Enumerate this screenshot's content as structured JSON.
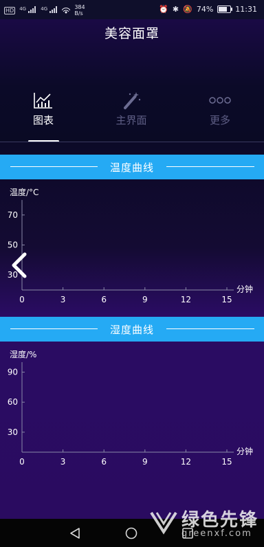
{
  "status_bar": {
    "network_hd": "HD",
    "sim1": "4G",
    "sim2": "4G",
    "speed_value": "384",
    "speed_unit": "B/s",
    "battery": "74%",
    "battery_level": 0.74,
    "time": "11:31"
  },
  "header": {
    "title": "美容面罩"
  },
  "tabs": [
    {
      "label": "图表",
      "icon": "chart-icon",
      "active": true
    },
    {
      "label": "主界面",
      "icon": "magic-wand-icon",
      "active": false
    },
    {
      "label": "更多",
      "icon": "more-dots-icon",
      "active": false
    }
  ],
  "temperature_chart": {
    "section_label": "温度曲线",
    "chart_data": {
      "type": "line",
      "title": "温度曲线",
      "ylabel": "温度/°C",
      "xlabel": "分钟",
      "x_ticks": [
        "0",
        "3",
        "6",
        "9",
        "12",
        "15"
      ],
      "y_ticks": [
        "70",
        "50",
        "30"
      ],
      "xlim": [
        0,
        15
      ],
      "ylim": [
        20,
        80
      ],
      "series": []
    }
  },
  "humidity_chart": {
    "section_label": "湿度曲线",
    "chart_data": {
      "type": "line",
      "title": "湿度曲线",
      "ylabel": "湿度/%",
      "xlabel": "分钟",
      "x_ticks": [
        "0",
        "3",
        "6",
        "9",
        "12",
        "15"
      ],
      "y_ticks": [
        "90",
        "60",
        "30"
      ],
      "xlim": [
        0,
        15
      ],
      "ylim": [
        10,
        100
      ],
      "series": []
    }
  },
  "navbar": {
    "back": "back-icon",
    "home": "home-icon",
    "recents": "recents-icon"
  },
  "watermark": {
    "text": "绿色先锋",
    "url": "greenxf.com"
  },
  "colors": {
    "accent": "#25aaf4",
    "background": "#2a0b60",
    "header": "#0b0a28"
  }
}
